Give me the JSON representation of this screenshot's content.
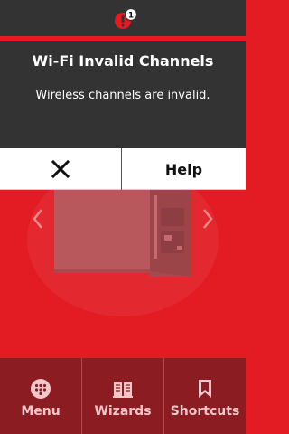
{
  "alert": {
    "title": "Wi-Fi Invalid Channels",
    "message": "Wireless channels are invalid.",
    "notification_count": "1",
    "status_icon": "warning-icon"
  },
  "actions": {
    "dismiss_icon": "close-icon",
    "help_label": "Help"
  },
  "carousel": {
    "image": "printer-image",
    "prev_icon": "chevron-left-icon",
    "next_icon": "chevron-right-icon"
  },
  "bottom_nav": {
    "items": [
      {
        "label": "Menu",
        "icon": "grid-dots-icon"
      },
      {
        "label": "Wizards",
        "icon": "book-icon"
      },
      {
        "label": "Shortcuts",
        "icon": "bookmark-icon"
      }
    ]
  },
  "colors": {
    "brand_red": "#e31b23",
    "dialog_bg": "#333333",
    "nav_bg": "#8a1c22",
    "nav_text": "#f3c7c9"
  }
}
